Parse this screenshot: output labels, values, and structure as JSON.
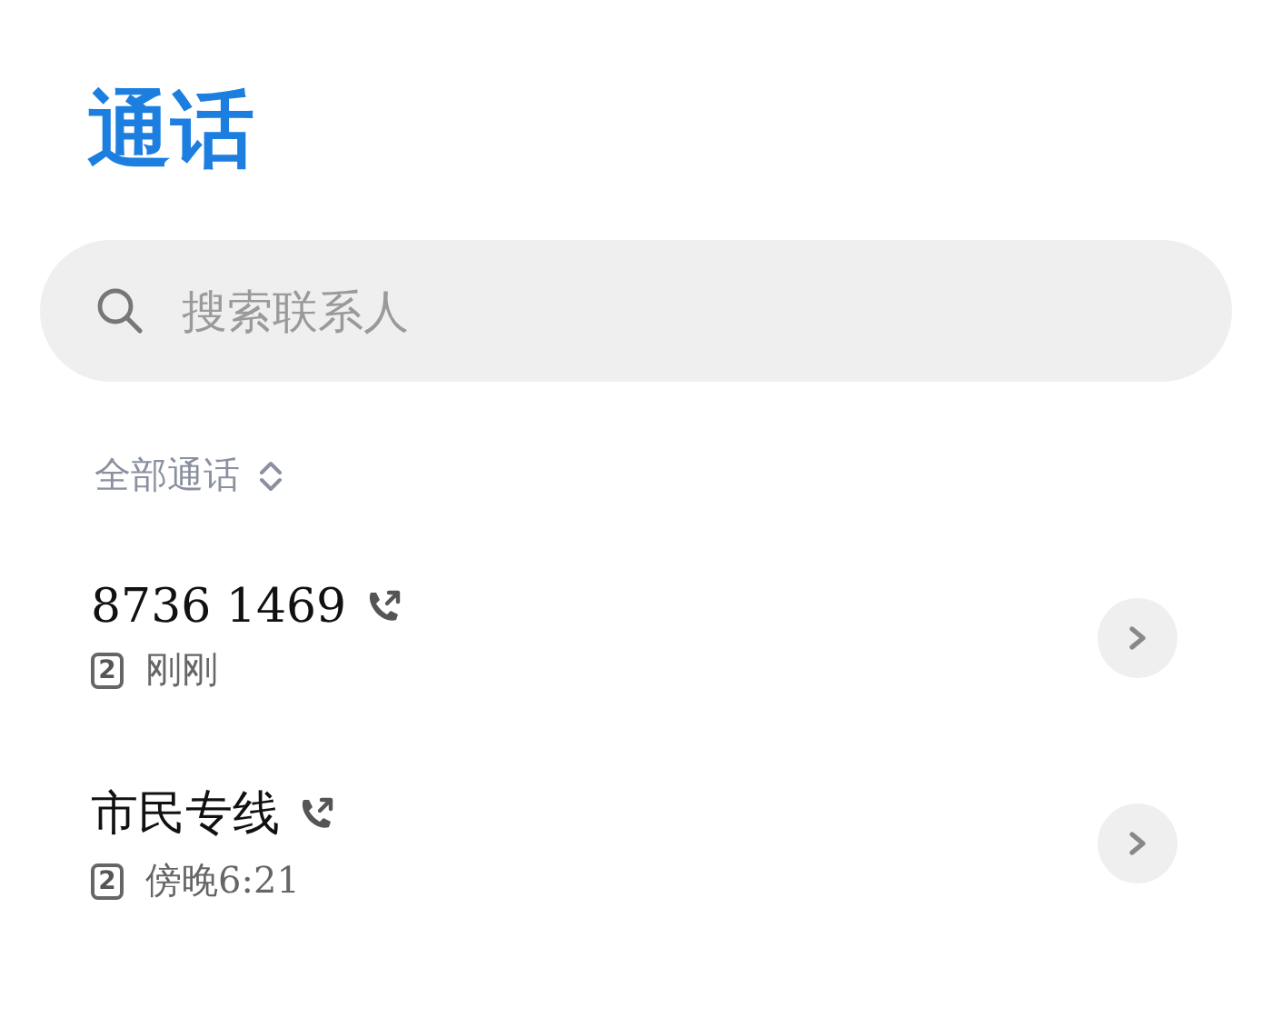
{
  "title": "通话",
  "search": {
    "placeholder": "搜索联系人"
  },
  "filter": {
    "label": "全部通话"
  },
  "calls": [
    {
      "name": "8736 1469",
      "sim": "2",
      "time": "刚刚"
    },
    {
      "name": "市民专线",
      "sim": "2",
      "time": "傍晚6:21"
    }
  ]
}
